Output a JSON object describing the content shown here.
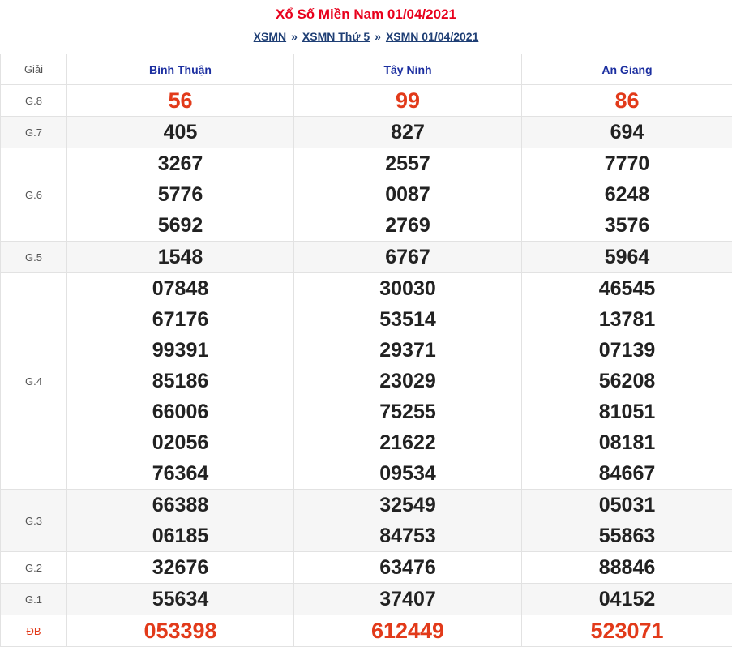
{
  "header": {
    "title": "Xổ Số Miền Nam 01/04/2021",
    "breadcrumb": [
      "XSMN",
      "XSMN Thứ 5",
      "XSMN 01/04/2021"
    ],
    "separator": "»"
  },
  "colors": {
    "title": "#e8001c",
    "breadcrumb": "#1f3f75",
    "province_header": "#1c2fa0",
    "special_numbers": "#e23a1a"
  },
  "table": {
    "label_header": "Giải",
    "provinces": [
      "Bình Thuận",
      "Tây Ninh",
      "An Giang"
    ],
    "prizes": [
      {
        "label": "G.8",
        "highlight": true,
        "results": [
          [
            "56"
          ],
          [
            "99"
          ],
          [
            "86"
          ]
        ]
      },
      {
        "label": "G.7",
        "highlight": false,
        "results": [
          [
            "405"
          ],
          [
            "827"
          ],
          [
            "694"
          ]
        ]
      },
      {
        "label": "G.6",
        "highlight": false,
        "results": [
          [
            "3267",
            "5776",
            "5692"
          ],
          [
            "2557",
            "0087",
            "2769"
          ],
          [
            "7770",
            "6248",
            "3576"
          ]
        ]
      },
      {
        "label": "G.5",
        "highlight": false,
        "results": [
          [
            "1548"
          ],
          [
            "6767"
          ],
          [
            "5964"
          ]
        ]
      },
      {
        "label": "G.4",
        "highlight": false,
        "results": [
          [
            "07848",
            "67176",
            "99391",
            "85186",
            "66006",
            "02056",
            "76364"
          ],
          [
            "30030",
            "53514",
            "29371",
            "23029",
            "75255",
            "21622",
            "09534"
          ],
          [
            "46545",
            "13781",
            "07139",
            "56208",
            "81051",
            "08181",
            "84667"
          ]
        ]
      },
      {
        "label": "G.3",
        "highlight": false,
        "results": [
          [
            "66388",
            "06185"
          ],
          [
            "32549",
            "84753"
          ],
          [
            "05031",
            "55863"
          ]
        ]
      },
      {
        "label": "G.2",
        "highlight": false,
        "results": [
          [
            "32676"
          ],
          [
            "63476"
          ],
          [
            "88846"
          ]
        ]
      },
      {
        "label": "G.1",
        "highlight": false,
        "results": [
          [
            "55634"
          ],
          [
            "37407"
          ],
          [
            "04152"
          ]
        ]
      },
      {
        "label": "ĐB",
        "highlight": true,
        "results": [
          [
            "053398"
          ],
          [
            "612449"
          ],
          [
            "523071"
          ]
        ]
      }
    ]
  }
}
